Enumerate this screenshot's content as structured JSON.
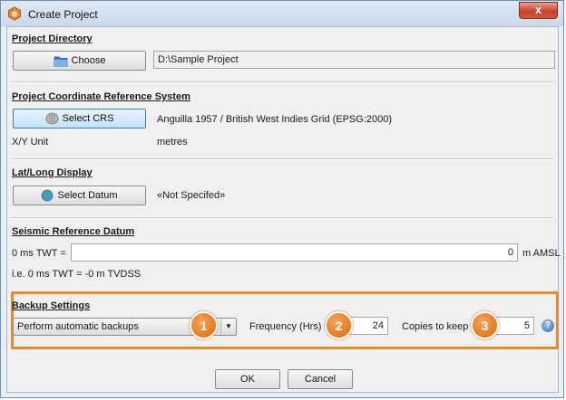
{
  "window": {
    "title": "Create Project",
    "close_glyph": "x"
  },
  "project_directory": {
    "heading": "Project Directory",
    "choose_label": "Choose",
    "path": "D:\\Sample Project"
  },
  "crs": {
    "heading": "Project Coordinate Reference System",
    "select_label": "Select CRS",
    "value": "Anguilla 1957 / British West Indies Grid (EPSG:2000)",
    "unit_label": "X/Y Unit",
    "unit_value": "metres"
  },
  "latlong": {
    "heading": "Lat/Long Display",
    "select_label": "Select Datum",
    "value": "«Not Specifed»"
  },
  "seismic": {
    "heading": "Seismic Reference Datum",
    "twt_label": "0 ms TWT =",
    "twt_value": "0",
    "twt_unit": "m AMSL",
    "note": "i.e. 0 ms TWT = -0 m TVDSS"
  },
  "backup": {
    "heading": "Backup Settings",
    "mode_selected": "Perform automatic backups",
    "frequency_label": "Frequency (Hrs)",
    "frequency_value": "24",
    "copies_label": "Copies to keep",
    "copies_value": "5",
    "help_glyph": "?"
  },
  "annotations": {
    "badge1": "1",
    "badge2": "2",
    "badge3": "3",
    "color": "#e98a2b"
  },
  "footer": {
    "ok_label": "OK",
    "cancel_label": "Cancel"
  },
  "icons": [
    "app-icon",
    "close-icon",
    "folder-icon",
    "grid-icon",
    "globe-icon",
    "chevron-down-icon",
    "help-icon"
  ]
}
